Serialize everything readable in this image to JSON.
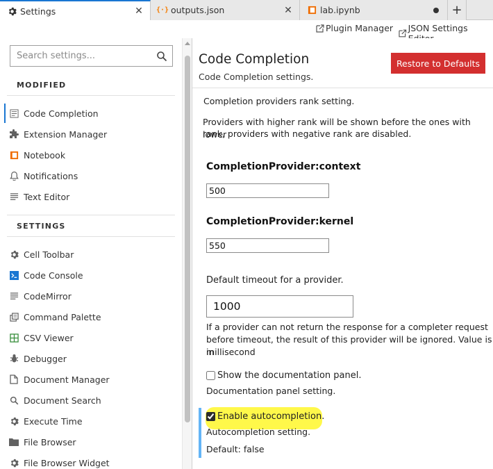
{
  "tabs": [
    {
      "label": "Settings",
      "icon": "gear-icon",
      "active": true
    },
    {
      "label": "outputs.json",
      "icon": "json-icon",
      "active": false
    },
    {
      "label": "lab.ipynb",
      "icon": "notebook-icon",
      "active": false,
      "modified": true
    }
  ],
  "toolbar": {
    "plugin_manager": "Plugin Manager",
    "json_editor": "JSON Settings Editor"
  },
  "sidebar": {
    "search_placeholder": "Search settings...",
    "modified_header": "MODIFIED",
    "settings_header": "SETTINGS",
    "modified_items": [
      {
        "label": "Code Completion",
        "icon": "code-completion-icon",
        "active": true
      },
      {
        "label": "Extension Manager",
        "icon": "puzzle-icon"
      },
      {
        "label": "Notebook",
        "icon": "notebook-icon"
      },
      {
        "label": "Notifications",
        "icon": "bell-icon"
      },
      {
        "label": "Text Editor",
        "icon": "text-editor-icon"
      }
    ],
    "settings_items": [
      {
        "label": "Cell Toolbar",
        "icon": "gear-icon"
      },
      {
        "label": "Code Console",
        "icon": "console-icon"
      },
      {
        "label": "CodeMirror",
        "icon": "text-editor-icon"
      },
      {
        "label": "Command Palette",
        "icon": "palette-icon"
      },
      {
        "label": "CSV Viewer",
        "icon": "csv-icon"
      },
      {
        "label": "Debugger",
        "icon": "bug-icon"
      },
      {
        "label": "Document Manager",
        "icon": "document-icon"
      },
      {
        "label": "Document Search",
        "icon": "search-icon"
      },
      {
        "label": "Execute Time",
        "icon": "gear-icon"
      },
      {
        "label": "File Browser",
        "icon": "folder-icon"
      },
      {
        "label": "File Browser Widget",
        "icon": "gear-icon"
      }
    ]
  },
  "main": {
    "title": "Code Completion",
    "subtitle": "Code Completion settings.",
    "restore_label": "Restore to Defaults",
    "providers_rank_desc": "Completion providers rank setting.",
    "providers_rank_note_1": "Providers with higher rank will be shown before the ones with lower",
    "providers_rank_note_2": "rank, providers with negative rank are disabled.",
    "context_label": "CompletionProvider:context",
    "context_value": "500",
    "kernel_label": "CompletionProvider:kernel",
    "kernel_value": "550",
    "timeout_label": "Default timeout for a provider.",
    "timeout_value": "1000",
    "timeout_desc_1": "If a provider can not return the response for a completer request",
    "timeout_desc_2": "before timeout, the result of this provider will be ignored. Value is in",
    "timeout_desc_3": "millisecond",
    "doc_panel_label": "Show the documentation panel.",
    "doc_panel_checked": false,
    "doc_panel_desc": "Documentation panel setting.",
    "autocomplete_label": "Enable autocompletion.",
    "autocomplete_checked": true,
    "autocomplete_desc": "Autocompletion setting.",
    "autocomplete_default": "Default: false"
  },
  "colors": {
    "accent": "#1976d2",
    "restore_button": "#d32f2f",
    "highlight": "#fff84a",
    "modified_bar": "#64b5f6"
  }
}
